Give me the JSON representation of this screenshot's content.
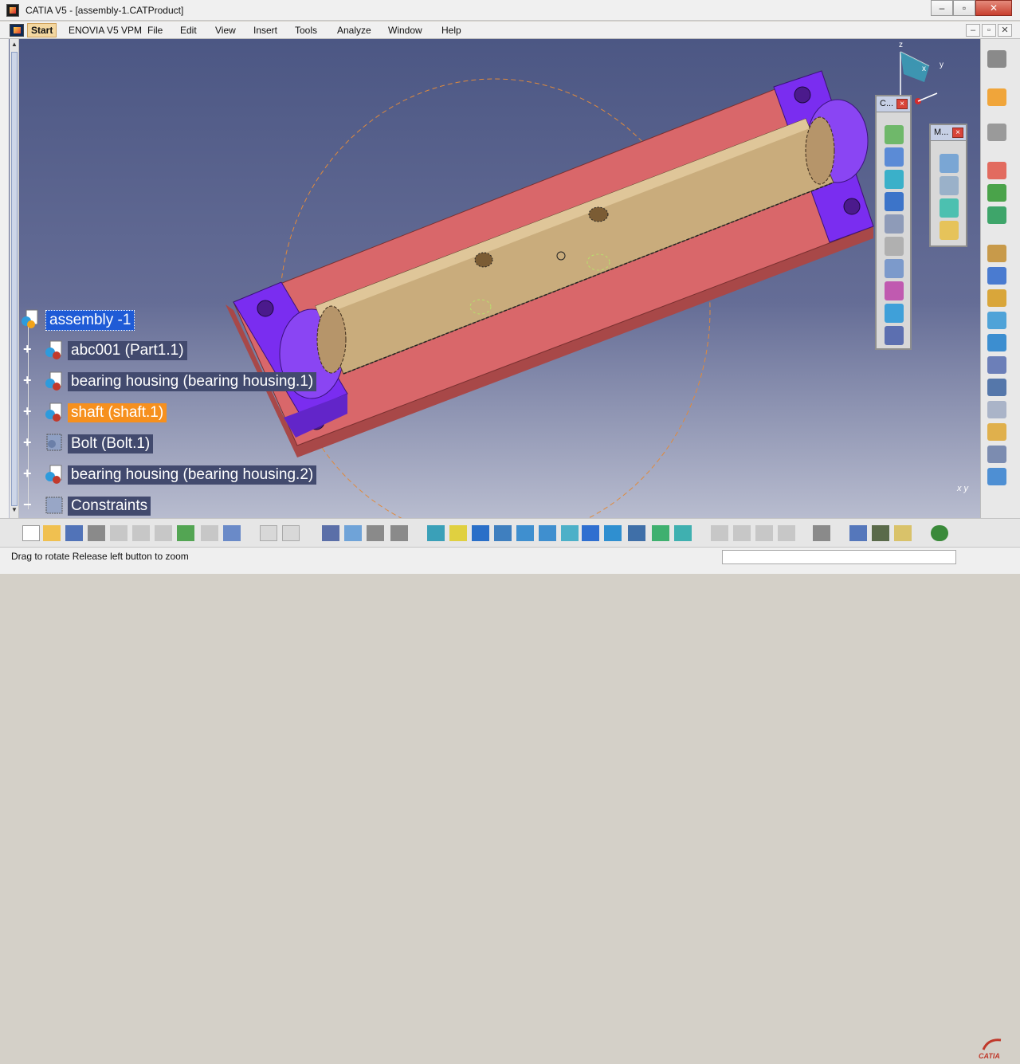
{
  "window": {
    "title": "CATIA V5 - [assembly-1.CATProduct]",
    "minimize": "–",
    "restore": "▫",
    "close": "✕"
  },
  "menu": {
    "items": [
      "Start",
      "ENOVIA V5 VPM",
      "File",
      "Edit",
      "View",
      "Insert",
      "Tools",
      "Analyze",
      "Window",
      "Help"
    ],
    "mdi_controls": [
      "–",
      "▫",
      "✕"
    ]
  },
  "tree": {
    "root": "assembly -1",
    "children": [
      {
        "label": "abc001 (Part1.1)",
        "icon": "part-icon",
        "expand": "+"
      },
      {
        "label": "bearing housing (bearing housing.1)",
        "icon": "product-icon",
        "expand": "+"
      },
      {
        "label": "shaft (shaft.1)",
        "icon": "product-icon",
        "expand": "+",
        "highlighted": true
      },
      {
        "label": "Bolt (Bolt.1)",
        "icon": "hidden-product-icon",
        "expand": "+"
      },
      {
        "label": "bearing housing (bearing housing.2)",
        "icon": "product-icon",
        "expand": "+"
      },
      {
        "label": "Constraints",
        "icon": "constraints-icon",
        "expand": "−"
      }
    ]
  },
  "floating_toolbars": [
    {
      "title": "C...",
      "close": "×"
    },
    {
      "title": "M...",
      "close": "×"
    }
  ],
  "compass": {
    "x": "x",
    "y": "y",
    "z": "z"
  },
  "axis_indicator": {
    "label": "x y"
  },
  "status": {
    "text": "Drag to rotate  Release left button to zoom"
  },
  "logo": {
    "text": "CATIA"
  },
  "colors": {
    "background_top": "#4c5784",
    "background_bottom": "#b8bccf",
    "base_plate": "#d9676a",
    "bearing_housing": "#7a2df0",
    "shaft": "#c9ac7c",
    "selection": "#1f5bd6",
    "highlight": "#f6901e"
  }
}
